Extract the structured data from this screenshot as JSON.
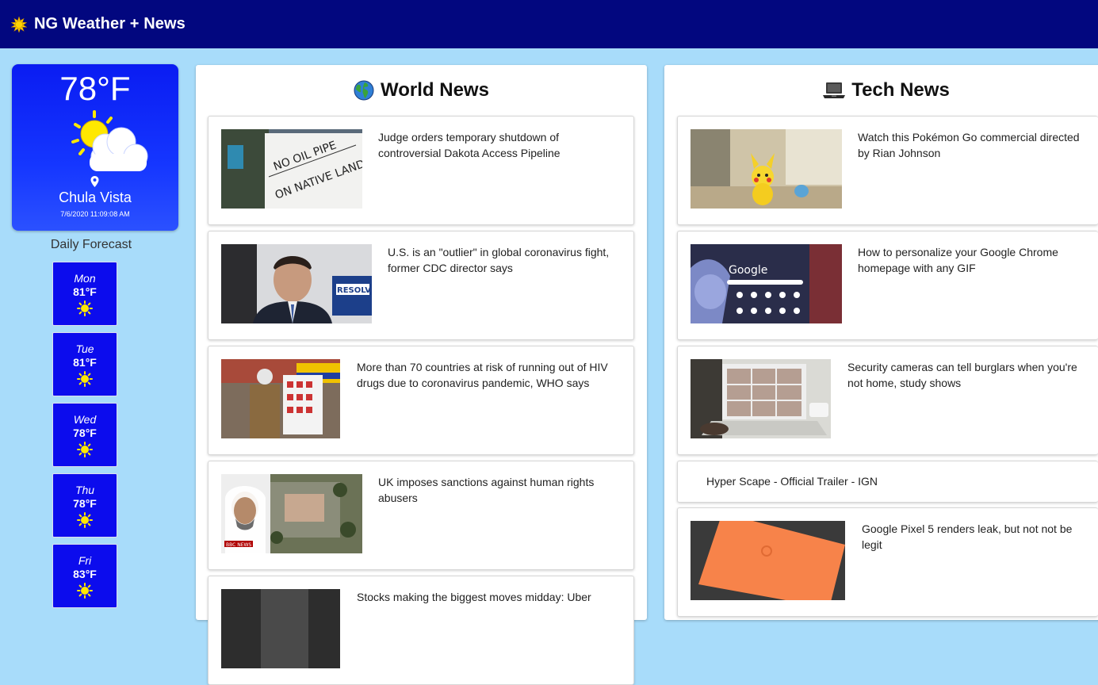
{
  "header": {
    "title": "NG Weather + News",
    "logo_icon": "sun-icon"
  },
  "current": {
    "temp": "78°F",
    "city": "Chula Vista",
    "datetime": "7/6/2020 11:09:08 AM",
    "icon": "partly-cloudy-icon"
  },
  "forecast": {
    "heading": "Daily Forecast",
    "days": [
      {
        "day": "Mon",
        "temp": "81°F",
        "icon": "sun-icon"
      },
      {
        "day": "Tue",
        "temp": "81°F",
        "icon": "sun-icon"
      },
      {
        "day": "Wed",
        "temp": "78°F",
        "icon": "sun-icon"
      },
      {
        "day": "Thu",
        "temp": "78°F",
        "icon": "sun-icon"
      },
      {
        "day": "Fri",
        "temp": "83°F",
        "icon": "sun-icon"
      }
    ]
  },
  "world": {
    "title": "World News",
    "icon": "globe-icon",
    "articles": [
      {
        "headline": "Judge orders temporary shutdown of controversial Dakota Access Pipeline"
      },
      {
        "headline": "U.S. is an \"outlier\" in global coronavirus fight, former CDC director says"
      },
      {
        "headline": "More than 70 countries at risk of running out of HIV drugs due to coronavirus pandemic, WHO says"
      },
      {
        "headline": "UK imposes sanctions against human rights abusers"
      },
      {
        "headline": "Stocks making the biggest moves midday: Uber"
      }
    ]
  },
  "tech": {
    "title": "Tech News",
    "icon": "laptop-icon",
    "articles": [
      {
        "headline": "Watch this Pokémon Go commercial directed by Rian Johnson"
      },
      {
        "headline": "How to personalize your Google Chrome homepage with any GIF"
      },
      {
        "headline": "Security cameras can tell burglars when you're not home, study shows"
      },
      {
        "headline": "Hyper Scape - Official Trailer - IGN"
      },
      {
        "headline": "Google Pixel 5 renders leak, but not not be legit"
      }
    ]
  },
  "colors": {
    "header_bg": "#02077f",
    "page_bg": "#a8dcfa",
    "forecast_card": "#0c0ced",
    "sun": "#ffe800"
  }
}
